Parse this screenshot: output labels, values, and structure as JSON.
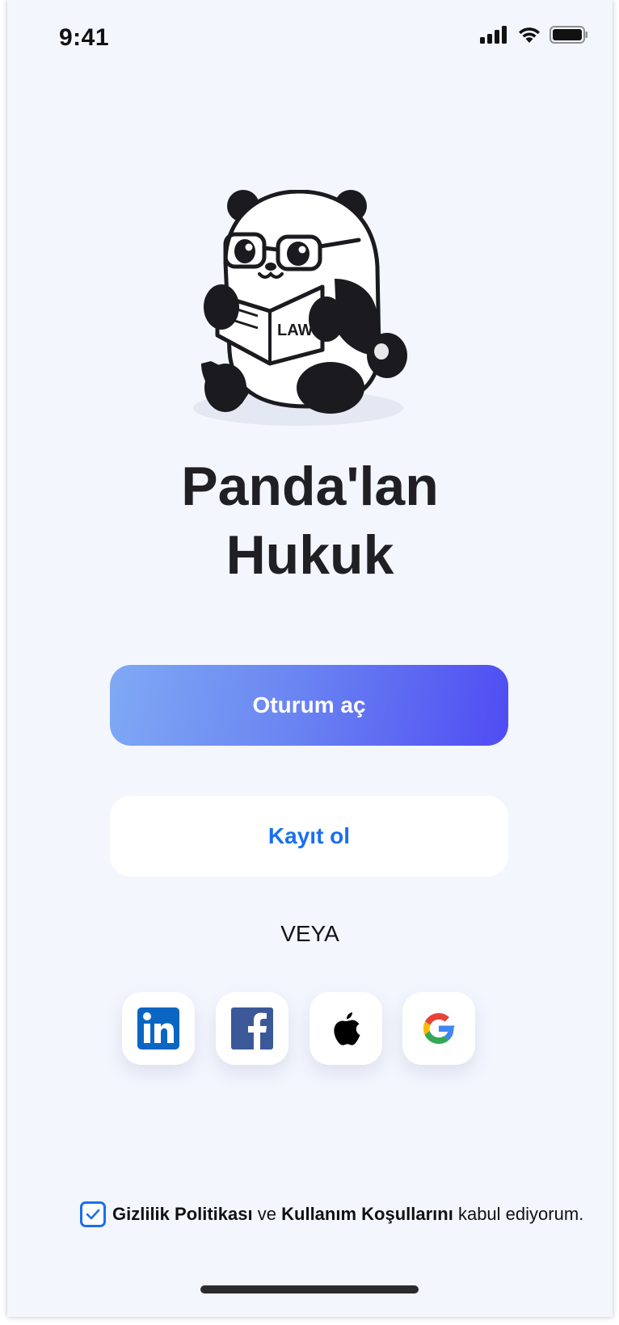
{
  "status_bar": {
    "time": "9:41"
  },
  "brand": {
    "title_line1": "Panda'lan",
    "title_line2": "Hukuk",
    "book_label": "LAW"
  },
  "actions": {
    "login_label": "Oturum aç",
    "signup_label": "Kayıt ol",
    "divider_text": "VEYA"
  },
  "social": [
    {
      "provider": "LinkedIn",
      "icon": "linkedin-icon"
    },
    {
      "provider": "Facebook",
      "icon": "facebook-icon"
    },
    {
      "provider": "Apple",
      "icon": "apple-icon"
    },
    {
      "provider": "Google",
      "icon": "google-icon"
    }
  ],
  "terms": {
    "privacy_link": "Gizlilik Politikası",
    "connector": "ve",
    "usage_link": "Kullanım Koşullarını",
    "suffix": "kabul ediyorum.",
    "checked": true
  },
  "colors": {
    "accent": "#1a6ff0",
    "gradient_start": "#7fa9f4",
    "gradient_end": "#4f4cf3",
    "background": "#f3f6fd"
  }
}
